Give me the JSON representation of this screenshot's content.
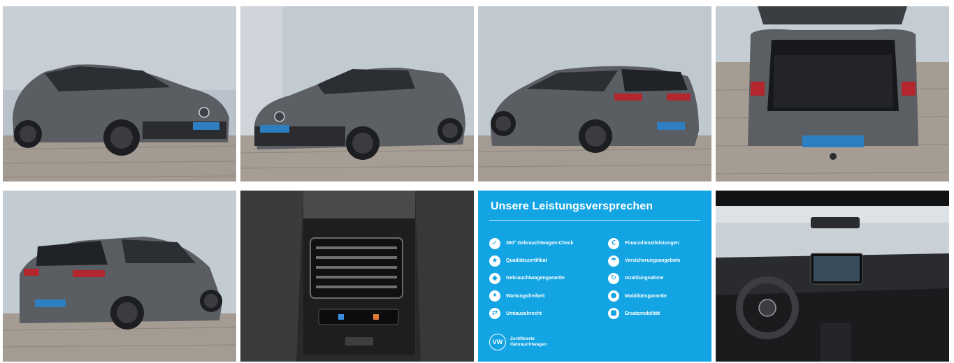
{
  "gallery": {
    "photos": [
      {
        "name": "photo-front-left-exterior",
        "alt": "Front left exterior"
      },
      {
        "name": "photo-front-right-exterior",
        "alt": "Front right exterior"
      },
      {
        "name": "photo-rear-left-exterior",
        "alt": "Rear left exterior"
      },
      {
        "name": "photo-open-trunk",
        "alt": "Open trunk"
      },
      {
        "name": "photo-rear-right-exterior",
        "alt": "Rear right exterior"
      },
      {
        "name": "photo-rear-air-vents",
        "alt": "Rear air vents"
      },
      {
        "name": "photo-dashboard-interior",
        "alt": "Dashboard interior"
      }
    ],
    "promo": {
      "title": "Unsere Leistungsversprechen",
      "left_items": [
        {
          "label": "360° Gebrauchtwagen-Check",
          "icon": "check-circle-icon"
        },
        {
          "label": "Qualitätszertifikat",
          "icon": "certificate-icon"
        },
        {
          "label": "Gebrauchtwagengarantie",
          "icon": "shield-icon"
        },
        {
          "label": "Wartungsfreiheit",
          "icon": "wrench-icon"
        },
        {
          "label": "Umtauschrecht",
          "icon": "exchange-icon"
        }
      ],
      "right_items": [
        {
          "label": "Finanzdienstleistungen",
          "icon": "finance-icon"
        },
        {
          "label": "Versicherungsangebote",
          "icon": "umbrella-icon"
        },
        {
          "label": "Inzahlungnahme",
          "icon": "trade-in-icon"
        },
        {
          "label": "Mobilitätsgarantie",
          "icon": "car-icon"
        },
        {
          "label": "Ersatzmobilität",
          "icon": "replacement-car-icon"
        }
      ],
      "brand_line1": "Zertifizierte",
      "brand_line2": "Gebrauchtwagen",
      "logo_text": "VW"
    },
    "colors": {
      "promo_blue": "#12a4e3",
      "car_grey": "#5a5d62"
    }
  }
}
